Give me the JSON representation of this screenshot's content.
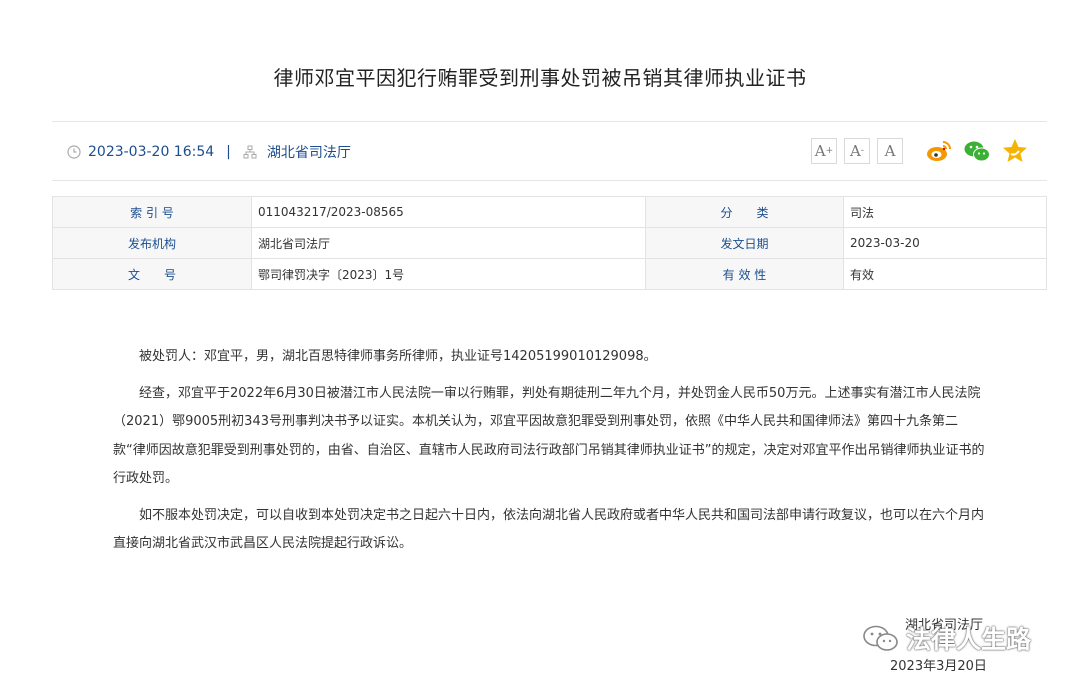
{
  "article": {
    "title": "律师邓宜平因犯行贿罪受到刑事处罚被吊销其律师执业证书",
    "datetime": "2023-03-20 16:54",
    "separator": "|",
    "source": "湖北省司法厅"
  },
  "toolbar": {
    "font_large": "A",
    "font_medium": "A",
    "font_small": "A"
  },
  "info_table": [
    {
      "label1": "索 引 号",
      "value1": "011043217/2023-08565",
      "label2": "分　　类",
      "value2": "司法"
    },
    {
      "label1": "发布机构",
      "value1": "湖北省司法厅",
      "label2": "发文日期",
      "value2": "2023-03-20"
    },
    {
      "label1": "文　　号",
      "value1": "鄂司律罚决字〔2023〕1号",
      "label2": "有 效 性",
      "value2": "有效"
    }
  ],
  "body": {
    "p1": "被处罚人：邓宜平，男，湖北百思特律师事务所律师，执业证号14205199010129098。",
    "p2": "经查，邓宜平于2022年6月30日被潜江市人民法院一审以行贿罪，判处有期徒刑二年九个月，并处罚金人民币50万元。上述事实有潜江市人民法院（2021）鄂9005刑初343号刑事判决书予以证实。本机关认为，邓宜平因故意犯罪受到刑事处罚，依照《中华人民共和国律师法》第四十九条第二款“律师因故意犯罪受到刑事处罚的，由省、自治区、直辖市人民政府司法行政部门吊销其律师执业证书”的规定，决定对邓宜平作出吊销律师执业证书的行政处罚。",
    "p3": "如不服本处罚决定，可以自收到本处罚决定书之日起六十日内，依法向湖北省人民政府或者中华人民共和国司法部申请行政复议，也可以在六个月内直接向湖北省武汉市武昌区人民法院提起行政诉讼。"
  },
  "signature": {
    "org": "湖北省司法厅",
    "date": "2023年3月20日"
  },
  "watermark": {
    "text": "法律人生路"
  },
  "colors": {
    "link_blue": "#1c4e8f",
    "weibo_orange": "#f39800",
    "wechat_green": "#3cb034",
    "star_yellow": "#f5b400"
  }
}
